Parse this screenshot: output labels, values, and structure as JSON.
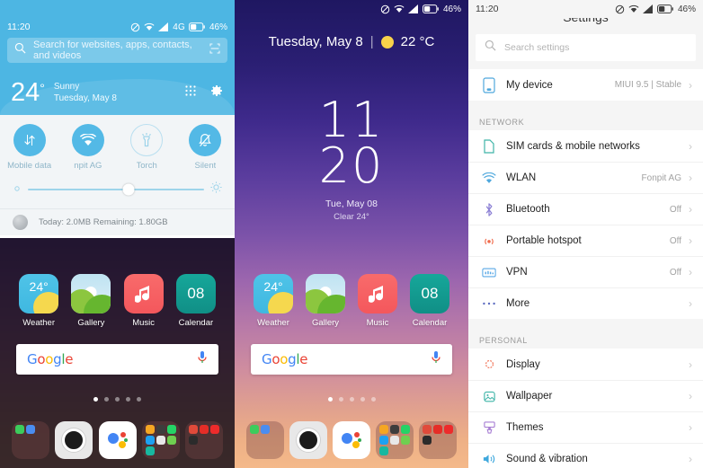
{
  "statusbar": {
    "time": "11:20",
    "network": "4G",
    "battery": "46%",
    "icons": [
      "dnd-icon",
      "wifi-icon",
      "signal-icon",
      "battery-icon"
    ]
  },
  "left_panel": {
    "search": {
      "placeholder": "Search for websites, apps, contacts, and videos",
      "icon": "search-icon",
      "scan_icon": "scan-icon"
    },
    "weather_header": {
      "temp": "24",
      "degree": "°",
      "condition": "Sunny",
      "date": "Tuesday, May 8",
      "grid_icon": "grid-icon",
      "settings_icon": "gear-icon"
    },
    "toggles": [
      {
        "label": "Mobile data",
        "icon": "mobile-data-icon",
        "active": true
      },
      {
        "label": "npit AG",
        "icon": "wifi-icon",
        "active": true
      },
      {
        "label": "Torch",
        "icon": "torch-icon",
        "active": false
      },
      {
        "label": "Silent",
        "icon": "silent-bell-icon",
        "active": true
      }
    ],
    "brightness": {
      "low_icon": "brightness-low-icon",
      "high_icon": "brightness-high-icon",
      "value": 57
    },
    "data_usage": "Today: 2.0MB  Remaining: 1.80GB"
  },
  "home": {
    "header": {
      "date": "Tuesday, May 8",
      "separator": "|",
      "temp": "22 °C",
      "sun_icon": "sun-icon"
    },
    "clock": {
      "hours": "11",
      "minutes": "20",
      "date": "Tue, May 08",
      "condition": "Clear  24°"
    },
    "apps": [
      {
        "label": "Weather",
        "icon": "weather-app-icon",
        "badge": "24°"
      },
      {
        "label": "Gallery",
        "icon": "gallery-app-icon"
      },
      {
        "label": "Music",
        "icon": "music-app-icon"
      },
      {
        "label": "Calendar",
        "icon": "calendar-app-icon",
        "badge": "08"
      }
    ],
    "google_bar": {
      "logo": [
        {
          "ch": "G",
          "color": "#4285f4"
        },
        {
          "ch": "o",
          "color": "#ea4335"
        },
        {
          "ch": "o",
          "color": "#fbbc05"
        },
        {
          "ch": "g",
          "color": "#4285f4"
        },
        {
          "ch": "l",
          "color": "#34a853"
        },
        {
          "ch": "e",
          "color": "#ea4335"
        }
      ],
      "mic_icon": "microphone-icon"
    },
    "page_dots": {
      "count": 5,
      "active": 0
    },
    "dock": [
      {
        "name": "dock-folder-communication",
        "type": "folder"
      },
      {
        "name": "dock-camera",
        "type": "camera"
      },
      {
        "name": "dock-google-assistant",
        "type": "assistant"
      },
      {
        "name": "dock-folder-apps",
        "type": "folder"
      },
      {
        "name": "dock-folder-media",
        "type": "folder"
      }
    ]
  },
  "settings": {
    "title": "Settings",
    "search": {
      "placeholder": "Search settings",
      "icon": "search-icon"
    },
    "my_device": {
      "label": "My device",
      "value": "MIUI 9.5 | Stable",
      "icon": "device-icon"
    },
    "groups": [
      {
        "title": "NETWORK",
        "rows": [
          {
            "label": "SIM cards & mobile networks",
            "value": "",
            "icon": "sim-card-icon",
            "color": "#3fb5a8"
          },
          {
            "label": "WLAN",
            "value": "Fonpit AG",
            "icon": "wifi-icon",
            "color": "#4fa8dd"
          },
          {
            "label": "Bluetooth",
            "value": "Off",
            "icon": "bluetooth-icon",
            "color": "#8b7fd4"
          },
          {
            "label": "Portable hotspot",
            "value": "Off",
            "icon": "hotspot-icon",
            "color": "#f06a4a"
          },
          {
            "label": "VPN",
            "value": "Off",
            "icon": "vpn-icon",
            "color": "#5aa9e6"
          },
          {
            "label": "More",
            "value": "",
            "icon": "more-dots-icon",
            "color": "#5c6bc0"
          }
        ]
      },
      {
        "title": "PERSONAL",
        "rows": [
          {
            "label": "Display",
            "value": "",
            "icon": "display-brightness-icon",
            "color": "#f0694a"
          },
          {
            "label": "Wallpaper",
            "value": "",
            "icon": "wallpaper-icon",
            "color": "#3fb5a8"
          },
          {
            "label": "Themes",
            "value": "",
            "icon": "themes-icon",
            "color": "#a87fd4"
          },
          {
            "label": "Sound & vibration",
            "value": "",
            "icon": "sound-icon",
            "color": "#3fa8dd"
          }
        ]
      }
    ],
    "chevron": "›"
  }
}
